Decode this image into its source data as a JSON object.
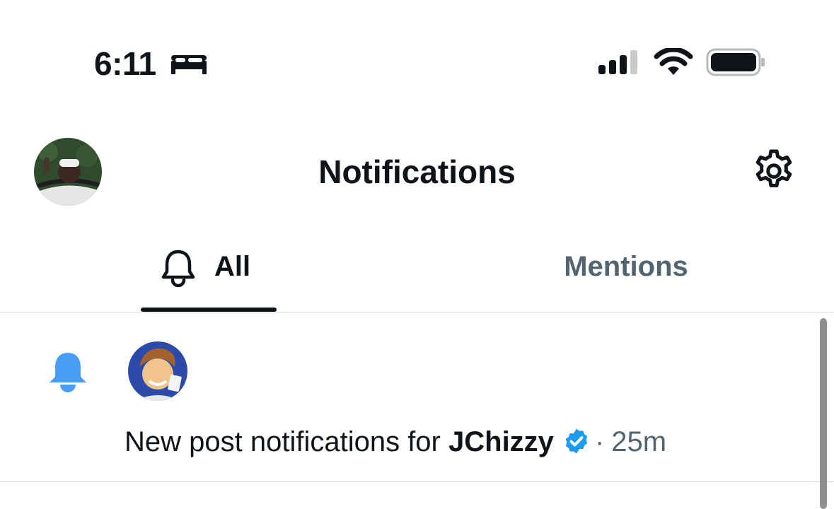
{
  "status_bar": {
    "time": "6:11",
    "icons": [
      "bed-icon",
      "cellular-signal-icon",
      "wifi-icon",
      "battery-icon"
    ]
  },
  "header": {
    "title": "Notifications",
    "avatar": "profile-avatar",
    "settings_icon": "gear-icon"
  },
  "tabs": [
    {
      "label": "All",
      "icon": "bell-icon",
      "selected": true
    },
    {
      "label": "Mentions",
      "selected": false
    }
  ],
  "notifications": [
    {
      "icon": "bell-icon",
      "avatar": "user-avatar",
      "text_prefix": "New post notifications for ",
      "username": "JChizzy",
      "verified": true,
      "separator": "·",
      "time": "25m"
    }
  ],
  "colors": {
    "accent": "#1d9bf0",
    "text_primary": "#0f1419",
    "text_secondary": "#536471",
    "bell_blue": "#4a9ef5"
  }
}
